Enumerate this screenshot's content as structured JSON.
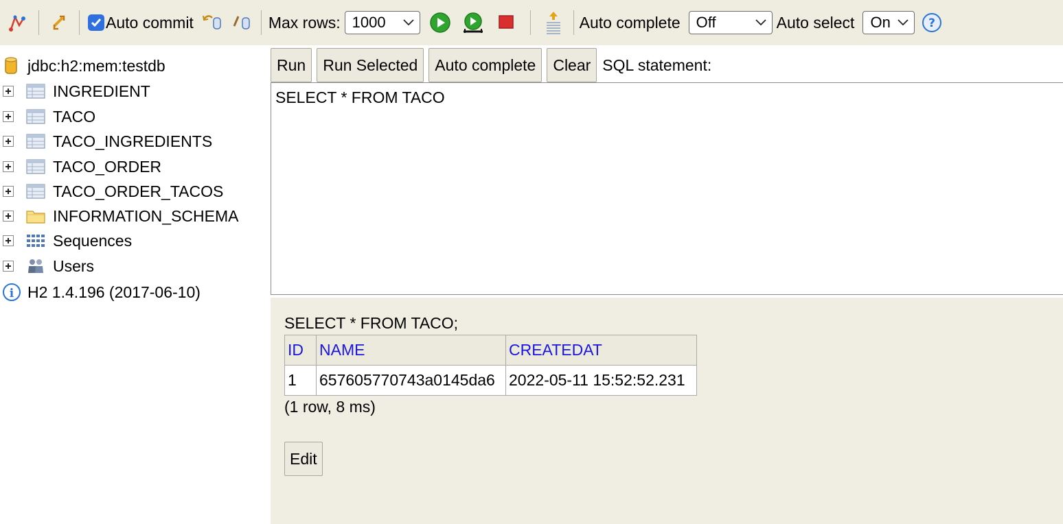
{
  "toolbar": {
    "auto_commit_label": "Auto commit",
    "auto_commit_checked": true,
    "max_rows_label": "Max rows:",
    "max_rows_value": "1000",
    "auto_complete_label": "Auto complete",
    "auto_complete_value": "Off",
    "auto_select_label": "Auto select",
    "auto_select_value": "On",
    "icons": [
      "disconnect-icon",
      "refresh-icon",
      "rollback-icon",
      "commit-icon",
      "run-icon",
      "run-selected-icon",
      "stop-icon",
      "history-icon",
      "help-icon"
    ],
    "colors": {
      "background": "#efece0",
      "run_green": "#2fa52f",
      "stop_red": "#d9302f",
      "help_blue": "#2b74d6"
    }
  },
  "tree": {
    "connection": "jdbc:h2:mem:testdb",
    "items": [
      {
        "label": "INGREDIENT",
        "icon": "table-icon"
      },
      {
        "label": "TACO",
        "icon": "table-icon"
      },
      {
        "label": "TACO_INGREDIENTS",
        "icon": "table-icon"
      },
      {
        "label": "TACO_ORDER",
        "icon": "table-icon"
      },
      {
        "label": "TACO_ORDER_TACOS",
        "icon": "table-icon"
      },
      {
        "label": "INFORMATION_SCHEMA",
        "icon": "folder-icon"
      },
      {
        "label": "Sequences",
        "icon": "sequences-icon"
      },
      {
        "label": "Users",
        "icon": "users-icon"
      }
    ],
    "version": "H2 1.4.196 (2017-06-10)"
  },
  "editor": {
    "buttons": {
      "run": "Run",
      "run_selected": "Run Selected",
      "auto_complete": "Auto complete",
      "clear": "Clear"
    },
    "sql_label": "SQL statement:",
    "sql_text": "SELECT * FROM TACO"
  },
  "result": {
    "query": "SELECT * FROM TACO;",
    "columns": [
      "ID",
      "NAME",
      "CREATEDAT"
    ],
    "rows": [
      [
        "1",
        "657605770743a0145da6",
        "2022-05-11 15:52:52.231"
      ]
    ],
    "info": "(1 row, 8 ms)",
    "edit_label": "Edit",
    "header_color": "#1a16e0"
  }
}
